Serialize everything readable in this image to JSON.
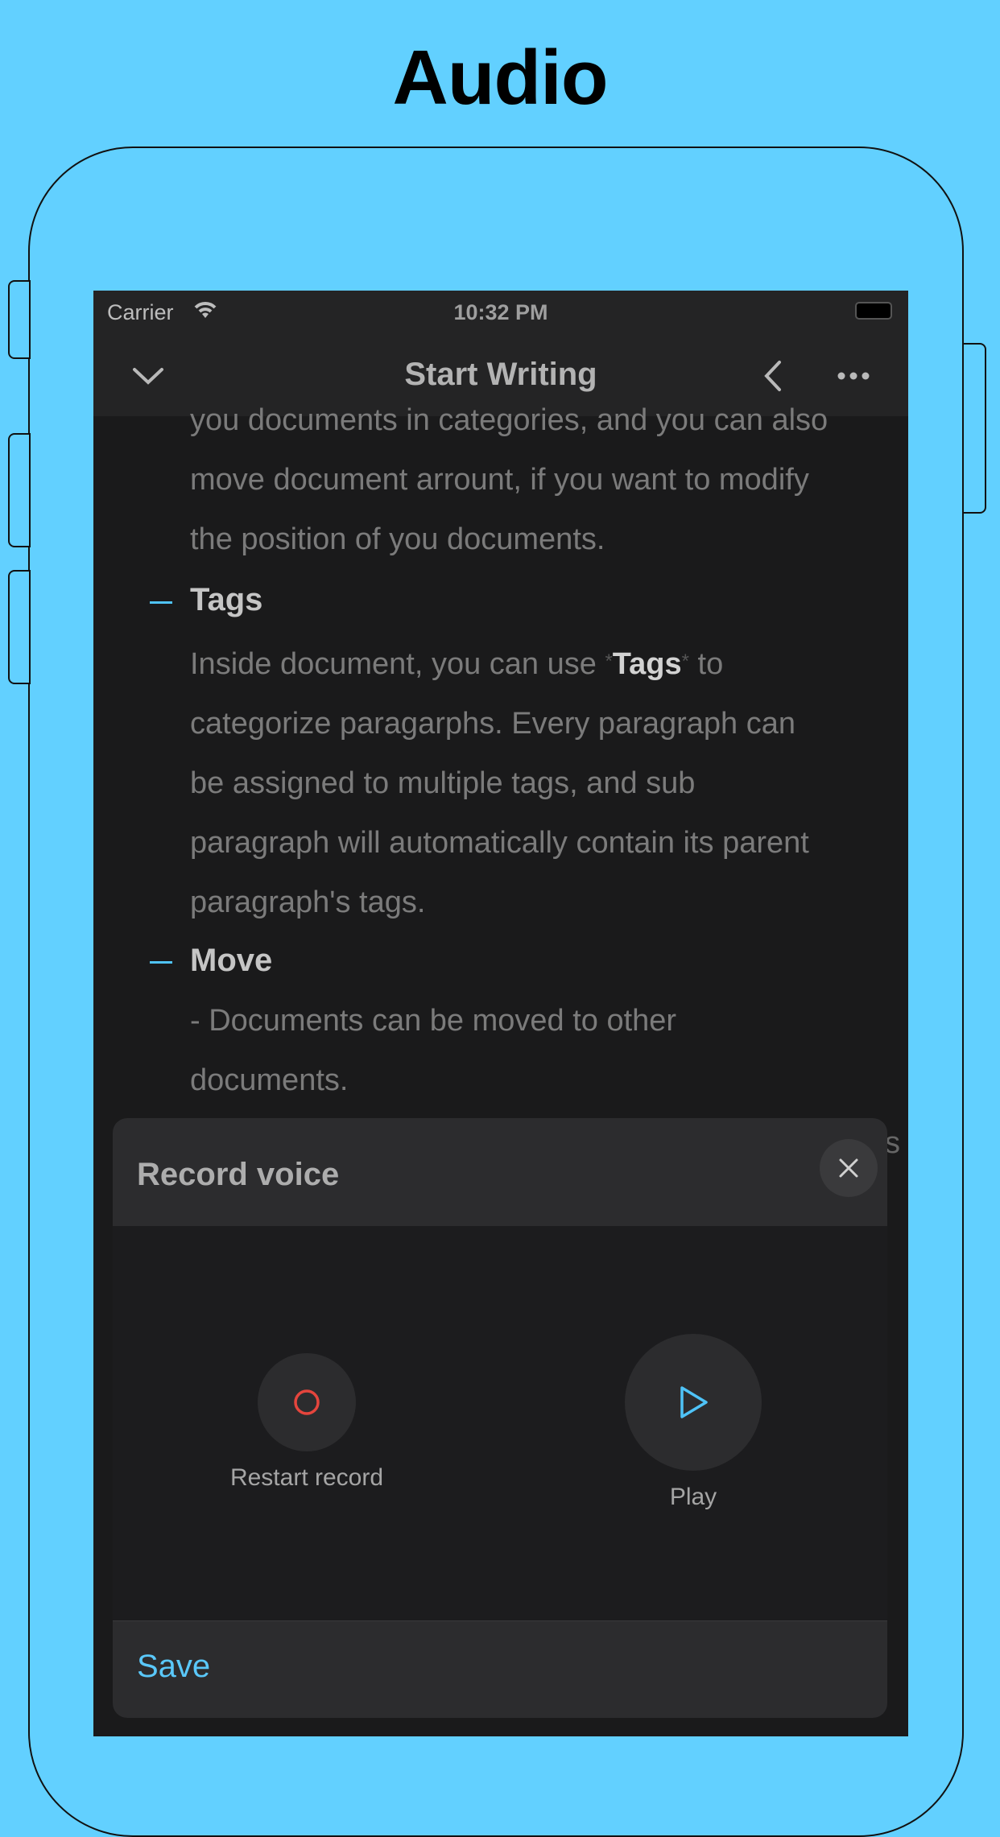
{
  "headline": "Audio",
  "status_bar": {
    "carrier": "Carrier",
    "time": "10:32 PM"
  },
  "nav": {
    "title": "Start Writing",
    "icons": [
      "chevron-down-icon",
      "back-chevron-icon",
      "more-icon"
    ]
  },
  "document": {
    "intro_lines": [
      "you documents in categories, and you can also",
      "move document arrount, if you want to modify",
      "the position of you documents."
    ],
    "sections": [
      {
        "heading": "Tags",
        "body_prefix": "Inside document, you can use ",
        "tag_marker": "*",
        "tag_word": "Tags",
        "body_suffix": " to",
        "lines": [
          "categorize paragarphs. Every paragraph can",
          "be assigned to multiple tags, and sub",
          "paragraph will automatically contain its parent",
          "paragraph's tags."
        ]
      },
      {
        "heading": "Move",
        "lines": [
          "- Documents can be moved to other",
          "documents."
        ]
      }
    ],
    "clipped_char": "s"
  },
  "record_sheet": {
    "title": "Record voice",
    "restart_label": "Restart record",
    "play_label": "Play",
    "save_label": "Save",
    "colors": {
      "record": "#e5453d",
      "play": "#4fc3f7",
      "save": "#5ac8fa"
    }
  }
}
